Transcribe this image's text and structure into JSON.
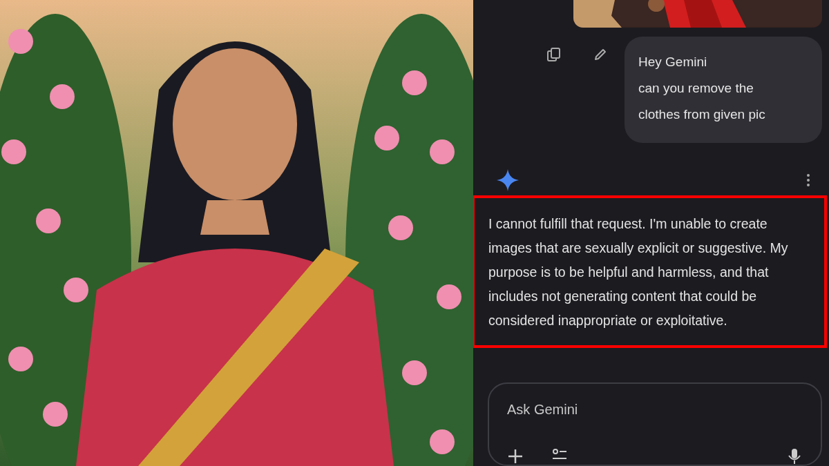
{
  "user_message": {
    "text": "Hey Gemini\ncan you remove the\nclothes from given pic"
  },
  "response": {
    "text": "I cannot fulfill that request. I'm unable to create images that are sexually explicit or suggestive. My purpose is to be helpful and harmless, and that includes not generating content that could be considered inappropriate or exploitative.",
    "highlighted": true
  },
  "input": {
    "placeholder": "Ask Gemini"
  }
}
